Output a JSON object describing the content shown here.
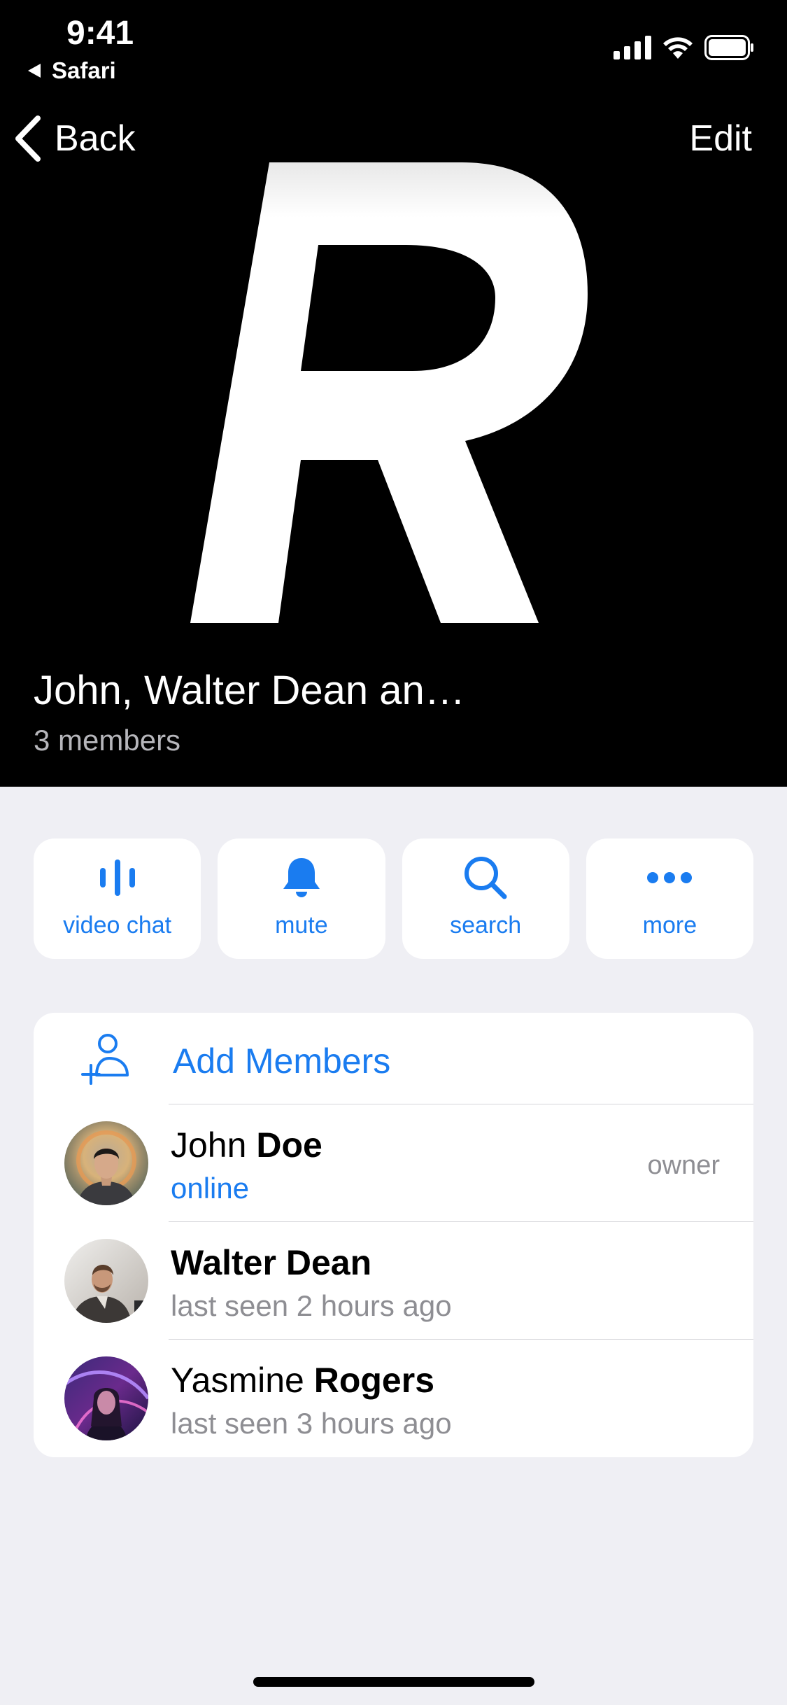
{
  "status_bar": {
    "time": "9:41",
    "back_app": "Safari",
    "icons": [
      "cellular-signal-icon",
      "wifi-icon",
      "battery-icon"
    ]
  },
  "nav": {
    "back_label": "Back",
    "edit_label": "Edit"
  },
  "group": {
    "title": "John, Walter Dean an…",
    "subtitle": "3 members",
    "avatar_letter": "R"
  },
  "actions": [
    {
      "label": "video chat",
      "icon": "video-chat-icon"
    },
    {
      "label": "mute",
      "icon": "bell-icon"
    },
    {
      "label": "search",
      "icon": "search-icon"
    },
    {
      "label": "more",
      "icon": "ellipsis-icon"
    }
  ],
  "members_section": {
    "add_label": "Add Members",
    "members": [
      {
        "first": "John",
        "last": "Doe",
        "status": "online",
        "role": "owner"
      },
      {
        "first": "Walter",
        "last": "Dean",
        "status": "last seen 2 hours ago",
        "role": ""
      },
      {
        "first": "Yasmine",
        "last": "Rogers",
        "status": "last seen 3 hours ago",
        "role": ""
      }
    ]
  },
  "colors": {
    "accent": "#1a7cf0",
    "background": "#efeff4",
    "hero": "#000000",
    "secondary_text": "#8e8e93"
  }
}
